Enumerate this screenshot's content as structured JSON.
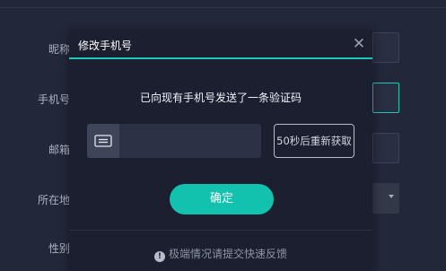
{
  "form": {
    "labels": {
      "nickname": "昵称",
      "phone": "手机号",
      "email": "邮箱",
      "location": "所在地",
      "gender": "性别"
    }
  },
  "dialog": {
    "title": "修改手机号",
    "close_label": "✕",
    "info_text": "已向现有手机号发送了一条验证码",
    "code_input": {
      "value": "",
      "placeholder": "",
      "icon": "sms-code-icon"
    },
    "resend_label": "50秒后重新获取",
    "confirm_label": "确定",
    "feedback_icon": "!",
    "feedback_text": "极端情况请提交快速反馈"
  },
  "colors": {
    "accent": "#1ec8b5",
    "button": "#12c2ae",
    "dialog_bg": "#1b1f2f",
    "page_bg": "#23273a"
  }
}
